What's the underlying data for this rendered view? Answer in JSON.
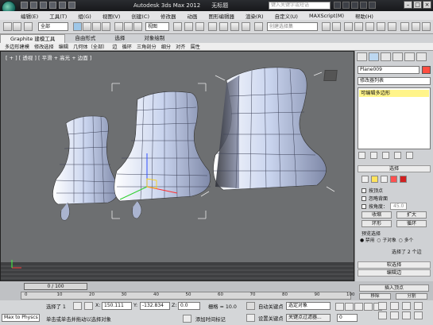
{
  "app": {
    "title": "Autodesk 3ds Max  2012",
    "doc_title": "无标题",
    "search_placeholder": "键入关键字或短语"
  },
  "menu": [
    "编辑(E)",
    "工具(T)",
    "组(G)",
    "视图(V)",
    "创建(C)",
    "修改器",
    "动画",
    "图形编辑器",
    "渲染(R)",
    "自定义(U)",
    "MAXScript(M)",
    "帮助(H)"
  ],
  "toolbar": {
    "selection_filter": "全部",
    "ref_coord": "视图",
    "named_selection": "创建选择集"
  },
  "ribbon": {
    "tabs": [
      "Graphite 建模工具",
      "自由形式",
      "选择",
      "对象绘制"
    ],
    "active_tab": 0,
    "subtabs": [
      "多边形建模",
      "修改选择",
      "编辑",
      "几何体（全部）",
      "边",
      "循环",
      "三角剖分",
      "细分",
      "对齐",
      "属性"
    ]
  },
  "viewport": {
    "label": "[ + ] [ 透视 ] [ 平滑 + 高光 + 边面 ]"
  },
  "command_panel": {
    "object_name": "Plane009",
    "object_color": "#ff4d40",
    "modifier_list": "修改器列表",
    "stack_item": "可编辑多边形",
    "selection_rollout": "选择",
    "checkboxes": [
      "按顶点",
      "忽略背面",
      "按角度："
    ],
    "angle_value": "45.0",
    "buttons": {
      "shrink": "收缩",
      "grow": "扩大",
      "ring": "环形",
      "loop": "循环"
    },
    "preview_label": "预览选择",
    "preview_options": [
      "禁用",
      "子对象",
      "多个"
    ],
    "selected_info": "选择了 2 个边",
    "soft_selection": "软选择",
    "edit_edges": "编辑边",
    "insert_vertex": "插入顶点",
    "remove_label": "移除",
    "split_label": "分割"
  },
  "timeline": {
    "frame": "0 / 100",
    "ticks": [
      "0",
      "10",
      "20",
      "30",
      "40",
      "50",
      "60",
      "70",
      "80",
      "90",
      "100"
    ]
  },
  "status": {
    "maxscript_label": "Max to Physcs",
    "selected": "选择了 1",
    "x_label": "X:",
    "x_value": "150.111",
    "y_label": "Y:",
    "y_value": "-132.834",
    "z_label": "Z:",
    "z_value": "0.0",
    "grid_label": "栅格 = 10.0",
    "prompt": "单击或单击并拖动以选择对象",
    "add_tag": "添加时间标记",
    "autokey": "自动关键点",
    "set_key": "设置关键点",
    "selected_obj": "选定对象",
    "key_filter": "关键点过滤器...",
    "frame_value": "0"
  }
}
